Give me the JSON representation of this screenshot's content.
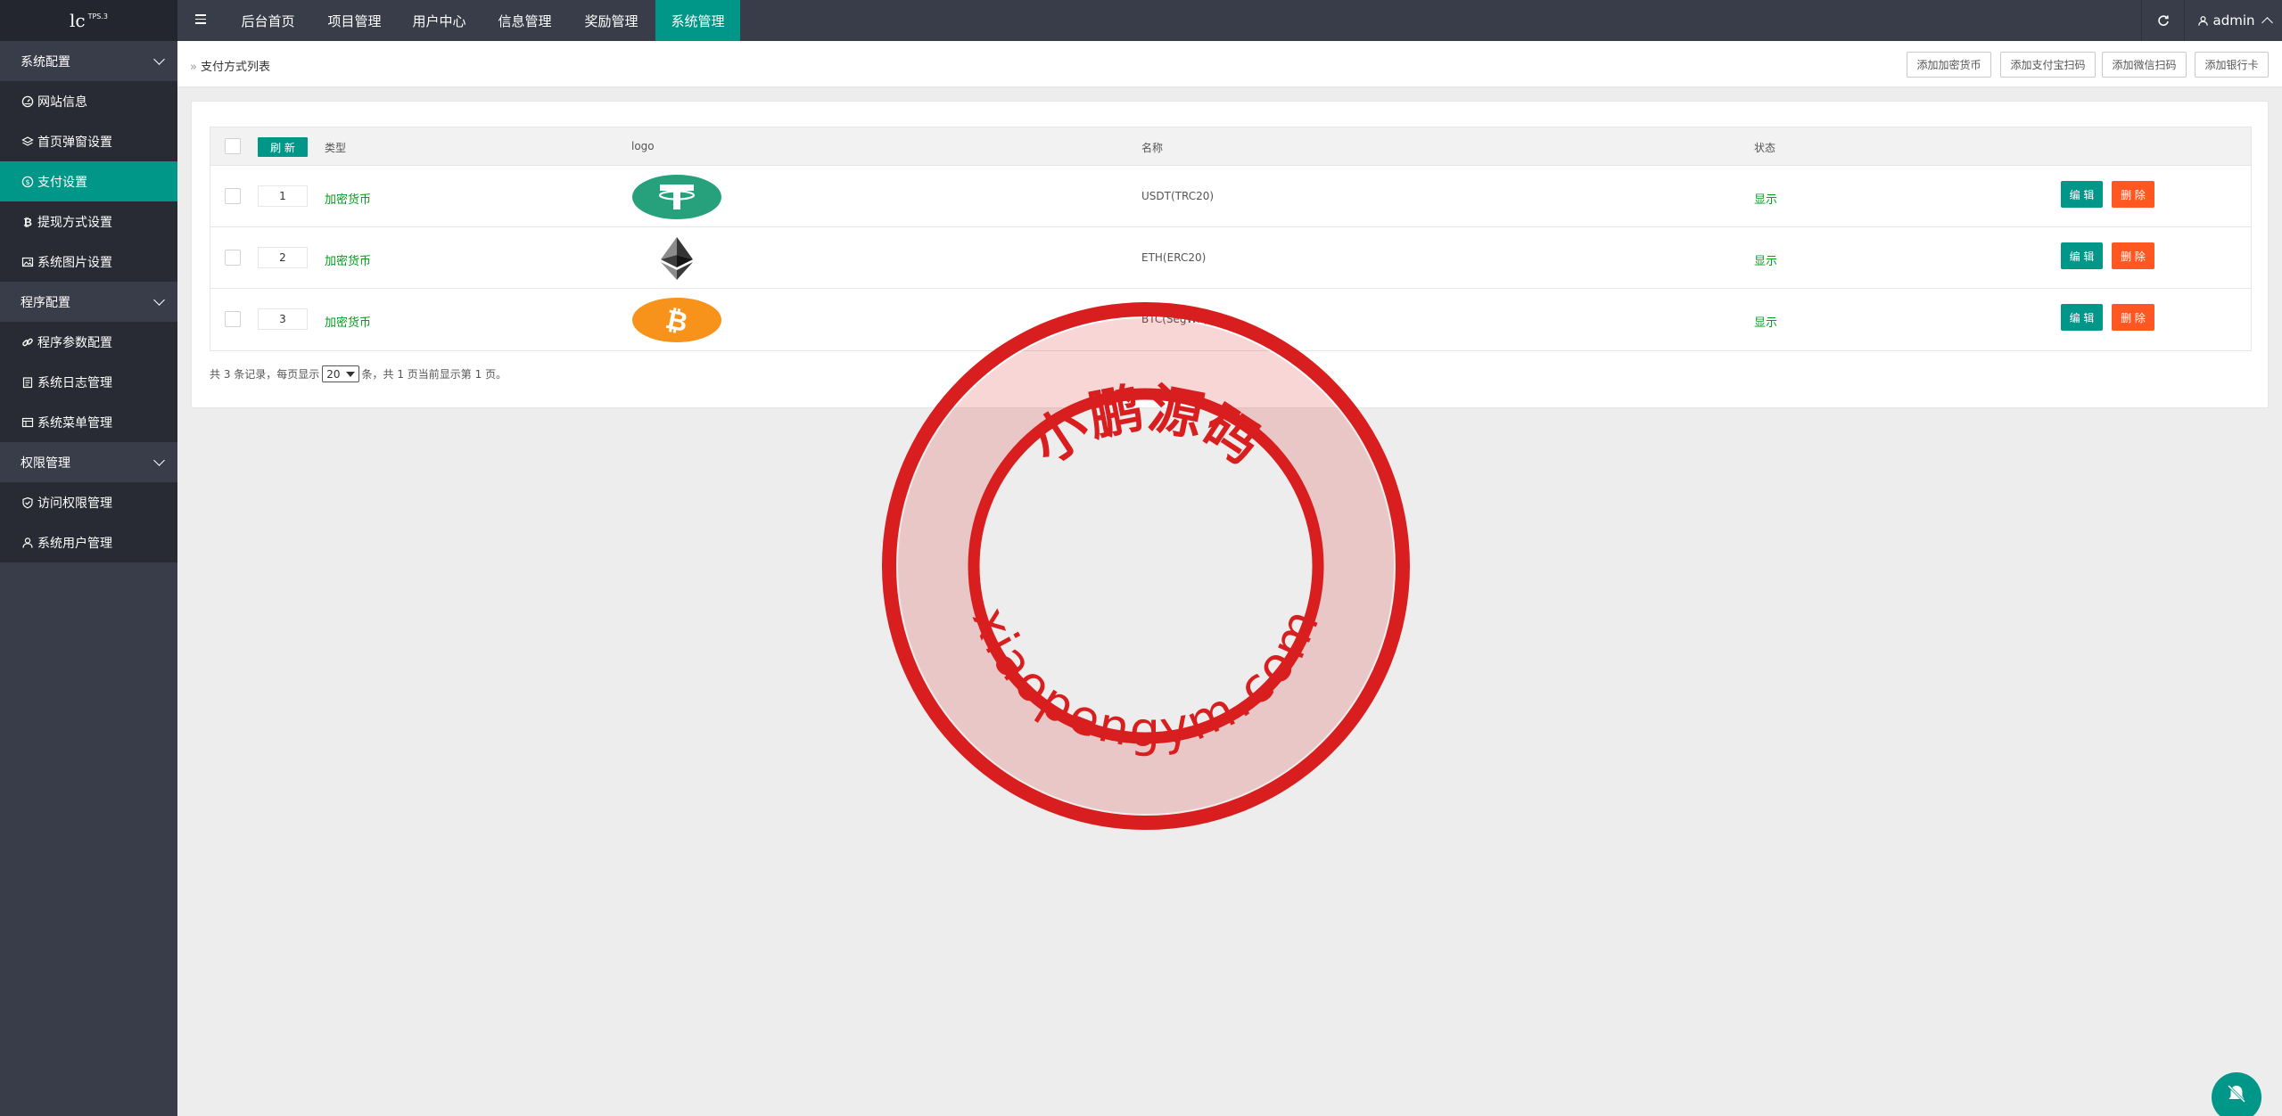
{
  "app": {
    "logo_main": "lc",
    "logo_sub": "TPS.3"
  },
  "topnav": {
    "items": [
      {
        "label": "后台首页"
      },
      {
        "label": "项目管理"
      },
      {
        "label": "用户中心"
      },
      {
        "label": "信息管理"
      },
      {
        "label": "奖励管理"
      },
      {
        "label": "系统管理",
        "active": true
      }
    ],
    "user": "admin"
  },
  "sidebar": {
    "groups": [
      {
        "label": "系统配置",
        "items": [
          {
            "label": "网站信息",
            "icon": "gauge-icon"
          },
          {
            "label": "首页弹窗设置",
            "icon": "layers-icon"
          },
          {
            "label": "支付设置",
            "icon": "dollar-circle-icon",
            "active": true
          },
          {
            "label": "提现方式设置",
            "icon": "bitcoin-icon"
          },
          {
            "label": "系统图片设置",
            "icon": "image-icon"
          }
        ]
      },
      {
        "label": "程序配置",
        "items": [
          {
            "label": "程序参数配置",
            "icon": "link-icon"
          },
          {
            "label": "系统日志管理",
            "icon": "clipboard-icon"
          },
          {
            "label": "系统菜单管理",
            "icon": "table-icon"
          }
        ]
      },
      {
        "label": "权限管理",
        "items": [
          {
            "label": "访问权限管理",
            "icon": "shield-icon"
          },
          {
            "label": "系统用户管理",
            "icon": "user-icon"
          }
        ]
      }
    ]
  },
  "breadcrumb": {
    "sep": "»",
    "title": "支付方式列表"
  },
  "toolbar": {
    "add_crypto": "添加加密货币",
    "add_alipay": "添加支付宝扫码",
    "add_wechat": "添加微信扫码",
    "add_bank": "添加银行卡"
  },
  "table": {
    "refresh_label": "刷 新",
    "headers": {
      "type": "类型",
      "logo": "logo",
      "name": "名称",
      "status": "状态"
    },
    "rows": [
      {
        "sort": "1",
        "type": "加密货币",
        "logo": "tether-logo",
        "name": "USDT(TRC20)",
        "status": "显示",
        "edit": "编 辑",
        "delete": "删 除"
      },
      {
        "sort": "2",
        "type": "加密货币",
        "logo": "ethereum-logo",
        "name": "ETH(ERC20)",
        "status": "显示",
        "edit": "编 辑",
        "delete": "删 除"
      },
      {
        "sort": "3",
        "type": "加密货币",
        "logo": "bitcoin-logo",
        "name": "BTC(SegWit)",
        "status": "显示",
        "edit": "编 辑",
        "delete": "删 除"
      }
    ]
  },
  "pager": {
    "prefix": "共 3 条记录，每页显示",
    "page_size": "20",
    "suffix": "条，共 1 页当前显示第 1 页。"
  },
  "watermark": {
    "text_top": "小鹏源码",
    "text_bottom": "xiaopengym.com"
  },
  "colors": {
    "primary": "#009688",
    "danger": "#ff5722",
    "nav_bg": "#393d49",
    "stamp_red": "#d81e1e"
  }
}
